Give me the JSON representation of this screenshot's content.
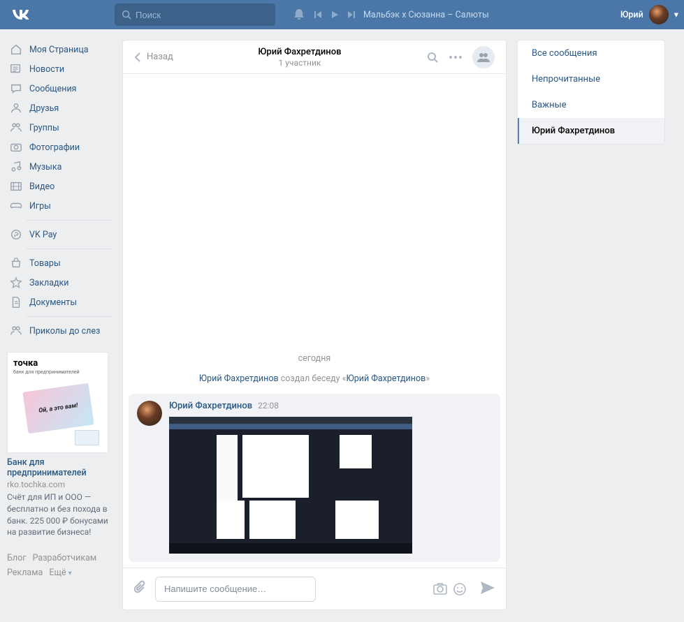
{
  "header": {
    "search_placeholder": "Поиск",
    "track": "Мальбэк x Сюзанна – Салюты",
    "user_name": "Юрий"
  },
  "left_nav_1": [
    {
      "icon": "home",
      "label": "Моя Страница"
    },
    {
      "icon": "news",
      "label": "Новости"
    },
    {
      "icon": "chat",
      "label": "Сообщения"
    },
    {
      "icon": "user",
      "label": "Друзья"
    },
    {
      "icon": "users",
      "label": "Группы"
    },
    {
      "icon": "camera",
      "label": "Фотографии"
    },
    {
      "icon": "music",
      "label": "Музыка"
    },
    {
      "icon": "video",
      "label": "Видео"
    },
    {
      "icon": "game",
      "label": "Игры"
    }
  ],
  "left_nav_2": [
    {
      "icon": "pay",
      "label": "VK Pay"
    }
  ],
  "left_nav_3": [
    {
      "icon": "bag",
      "label": "Товары"
    },
    {
      "icon": "star",
      "label": "Закладки"
    },
    {
      "icon": "doc",
      "label": "Документы"
    }
  ],
  "left_nav_4": [
    {
      "icon": "users",
      "label": "Приколы до слез"
    }
  ],
  "ad": {
    "brand": "точка",
    "brand_sub": "банк для предпринимателей",
    "card_line": "Ой, а это вам!",
    "title": "Банк для предпринимателей",
    "domain": "rko.tochka.com",
    "desc": "Счёт для ИП и ООО — бесплатно и без похода в банк. 225 000 ₽ бонусами на развитие бизнеса!"
  },
  "footer": {
    "l1": "Блог",
    "l2": "Разработчикам",
    "l3": "Реклама",
    "l4": "Ещё"
  },
  "chat": {
    "back": "Назад",
    "title": "Юрий Фахретдинов",
    "subtitle": "1 участник",
    "date": "сегодня",
    "sys_u1": "Юрий Фахретдинов",
    "sys_mid": " создал беседу «",
    "sys_u2": "Юрий Фахретдинов",
    "sys_end": "»",
    "msg_name": "Юрий Фахретдинов",
    "msg_time": "22:08",
    "input_placeholder": "Напишите сообщение…"
  },
  "filters": [
    {
      "label": "Все сообщения",
      "active": false
    },
    {
      "label": "Непрочитанные",
      "active": false
    },
    {
      "label": "Важные",
      "active": false
    },
    {
      "label": "Юрий Фахретдинов",
      "active": true
    }
  ]
}
